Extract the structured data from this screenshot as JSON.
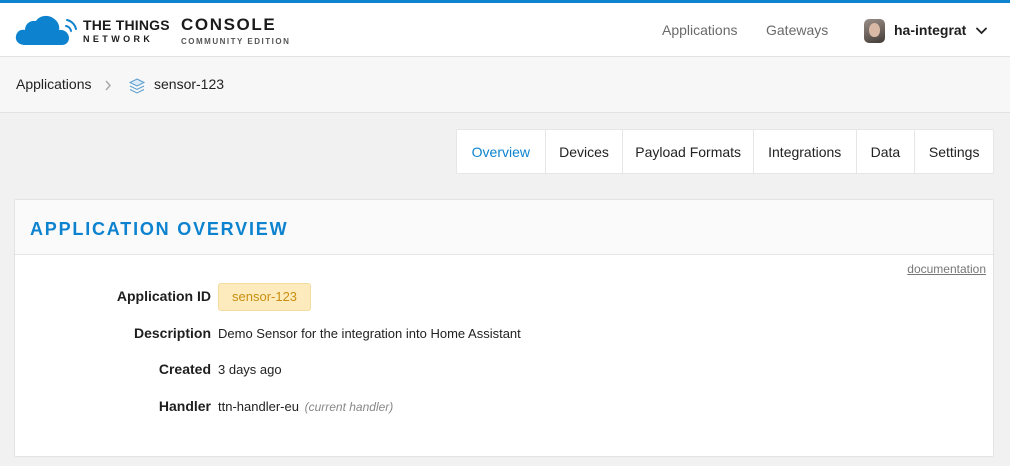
{
  "header": {
    "logo": {
      "line1": "THE THINGS",
      "line2": "NETWORK",
      "product": "CONSOLE",
      "edition": "COMMUNITY EDITION"
    },
    "nav": [
      {
        "label": "Applications"
      },
      {
        "label": "Gateways"
      }
    ],
    "user": {
      "name": "ha-integrat"
    }
  },
  "breadcrumb": {
    "root": "Applications",
    "current": "sensor-123"
  },
  "tabs": [
    {
      "label": "Overview",
      "active": true
    },
    {
      "label": "Devices",
      "active": false
    },
    {
      "label": "Payload Formats",
      "active": false
    },
    {
      "label": "Integrations",
      "active": false
    },
    {
      "label": "Data",
      "active": false
    },
    {
      "label": "Settings",
      "active": false
    }
  ],
  "overview": {
    "title": "APPLICATION OVERVIEW",
    "doc_link": "documentation",
    "fields": {
      "app_id": {
        "label": "Application ID",
        "value": "sensor-123"
      },
      "description": {
        "label": "Description",
        "value": "Demo Sensor for the integration into Home Assistant"
      },
      "created": {
        "label": "Created",
        "value": "3 days ago"
      },
      "handler": {
        "label": "Handler",
        "value": "ttn-handler-eu",
        "note": "(current handler)"
      }
    }
  },
  "colors": {
    "accent": "#0d83d0",
    "badge_bg": "#fdebbd",
    "badge_text": "#c98f10"
  }
}
